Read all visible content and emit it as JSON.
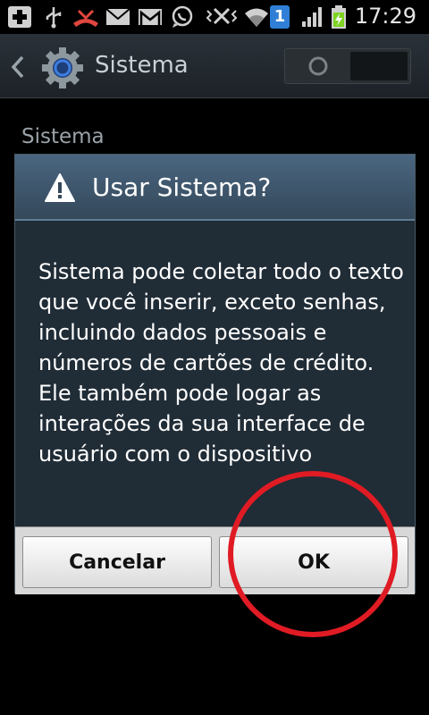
{
  "status_bar": {
    "time": "17:29",
    "notification_count": "1",
    "icons": [
      "add-icon",
      "usb-icon",
      "missed-call-icon",
      "email-icon",
      "gmail-icon",
      "whatsapp-icon",
      "vibrate-icon",
      "wifi-icon",
      "notification-badge-icon",
      "signal-icon",
      "battery-icon"
    ],
    "battery_color": "#7ed321"
  },
  "action_bar": {
    "title": "Sistema",
    "icons": [
      "back-icon",
      "gear-icon",
      "toggle-switch"
    ]
  },
  "page": {
    "section_label": "Sistema"
  },
  "dialog": {
    "title": "Usar Sistema?",
    "message": "Sistema pode coletar todo o texto que você inserir, exceto senhas, incluindo dados pessoais e números de cartões de crédito. Ele também pode logar as interações da sua interface de usuário com o dispositivo",
    "cancel_label": "Cancelar",
    "ok_label": "OK"
  },
  "annotation": {
    "shape": "circle",
    "color": "#e01b24",
    "target": "ok-button"
  }
}
